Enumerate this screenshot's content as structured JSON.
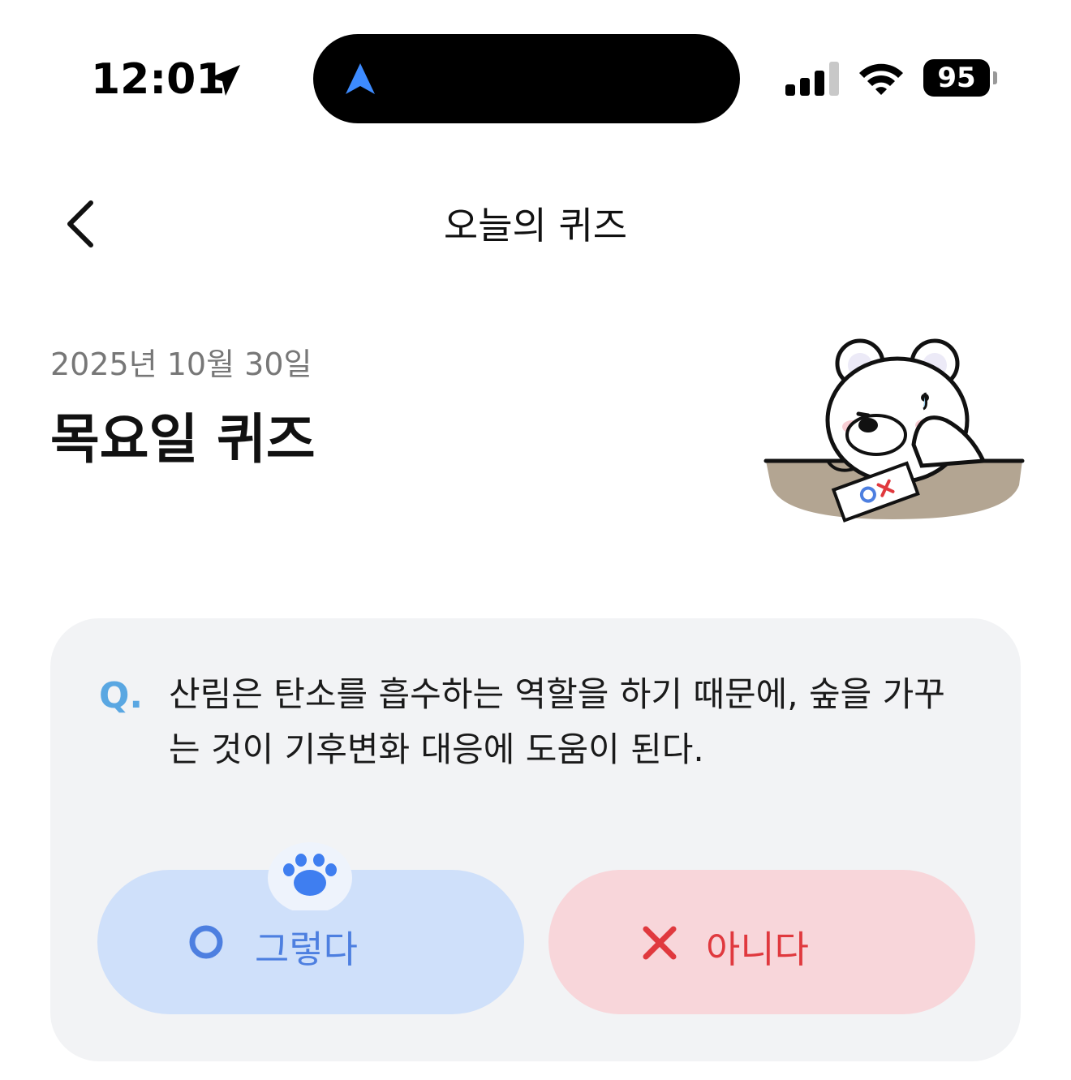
{
  "status_bar": {
    "time": "12:01",
    "battery_level": "95",
    "signal_bars": 3,
    "icons": [
      "location-arrow-icon",
      "navigation-icon",
      "cellular-signal-icon",
      "wifi-icon",
      "battery-icon"
    ]
  },
  "nav": {
    "title": "오늘의 퀴즈",
    "back_icon": "chevron-left-icon"
  },
  "header": {
    "date": "2025년 10월 30일",
    "title": "목요일 퀴즈",
    "illustration": "bear-mascot-with-ox-card"
  },
  "quiz": {
    "q_mark": "Q.",
    "question": "산림은 탄소를 흡수하는 역할을 하기 때문에, 숲을 가꾸는 것이 기후변화 대응에 도움이 된다.",
    "options": {
      "yes": {
        "label": "그렇다",
        "icon": "circle-o-icon",
        "color": "#4d7fe0"
      },
      "no": {
        "label": "아니다",
        "icon": "x-icon",
        "color": "#e0393e"
      }
    },
    "selected_indicator": "paw-icon"
  },
  "colors": {
    "card_bg": "#f2f3f5",
    "yes_bg": "#cfe0fa",
    "no_bg": "#f8d6da",
    "accent_q": "#5aa7e2"
  }
}
